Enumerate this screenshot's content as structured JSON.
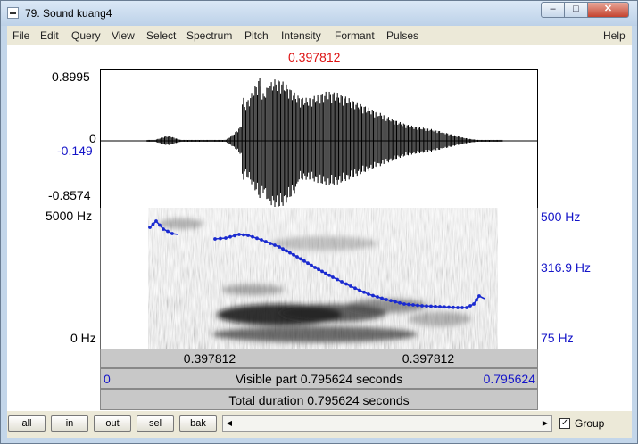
{
  "window": {
    "title": "79. Sound kuang4"
  },
  "menu": {
    "items": [
      "File",
      "Edit",
      "Query",
      "View",
      "Select",
      "Spectrum",
      "Pitch",
      "Intensity",
      "Formant",
      "Pulses",
      "Help"
    ]
  },
  "cursor": {
    "time": "0.397812"
  },
  "waveform": {
    "max_label": "0.8995",
    "zero_label": "0",
    "cursor_value": "-0.149",
    "min_label": "-0.8574"
  },
  "spectrogram": {
    "top_freq": "5000 Hz",
    "bottom_freq": "0 Hz"
  },
  "pitch": {
    "top": "500 Hz",
    "cursor_value": "316.9 Hz",
    "bottom": "75 Hz"
  },
  "time_bars": {
    "left_segment": "0.397812",
    "right_segment": "0.397812",
    "visible_start": "0",
    "visible_label": "Visible part 0.795624 seconds",
    "visible_end": "0.795624",
    "total_label": "Total duration 0.795624 seconds"
  },
  "buttons": {
    "all": "all",
    "in": "in",
    "out": "out",
    "sel": "sel",
    "bak": "bak"
  },
  "group": {
    "label": "Group",
    "checked": true,
    "check_mark": "✓"
  },
  "colors": {
    "cursor": "#dd1111",
    "axis_blue": "#1414c8",
    "pitch_line": "#1a2ad0"
  }
}
